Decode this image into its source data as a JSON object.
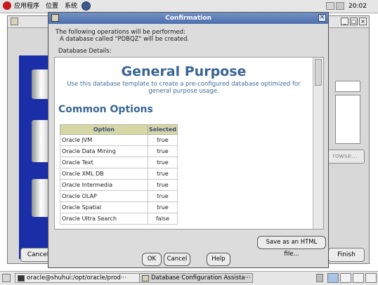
{
  "top_panel": {
    "menus": [
      "应用程序",
      "位置",
      "系统"
    ],
    "clock": "20:02"
  },
  "background_window": {
    "browse_label": "rowse...",
    "cancel_label": "Cancel",
    "finish_label": "Finish"
  },
  "dialog": {
    "title": "Confirmation",
    "close_glyph": "✕",
    "intro_line": "The following operations will be performed:",
    "operation_line": "A database called \"PDBQZ\" will be created.",
    "details_label": "Database Details:",
    "template_title": "General Purpose",
    "template_desc": "Use this database template to create a pre-configured database optimized for general purpose usage.",
    "section_title": "Common Options",
    "table": {
      "headers": [
        "Option",
        "Selected"
      ],
      "rows": [
        [
          "Oracle JVM",
          "true"
        ],
        [
          "Oracle Data Mining",
          "true"
        ],
        [
          "Oracle Text",
          "true"
        ],
        [
          "Oracle XML DB",
          "true"
        ],
        [
          "Oracle Intermedia",
          "true"
        ],
        [
          "Oracle OLAP",
          "true"
        ],
        [
          "Oracle Spatial",
          "true"
        ],
        [
          "Oracle Ultra Search",
          "false"
        ]
      ]
    },
    "save_html_label": "Save as an HTML file...",
    "ok_label": "OK",
    "cancel_label": "Cancel",
    "help_label": "Help"
  },
  "taskbar": {
    "tasks": [
      "oracle@shuhui:/opt/oracle/prod···",
      "Database Configuration Assista···"
    ]
  },
  "colors": {
    "title_bar": "#4d6fae",
    "heading_blue": "#396594",
    "table_header": "#d7d7a6"
  }
}
